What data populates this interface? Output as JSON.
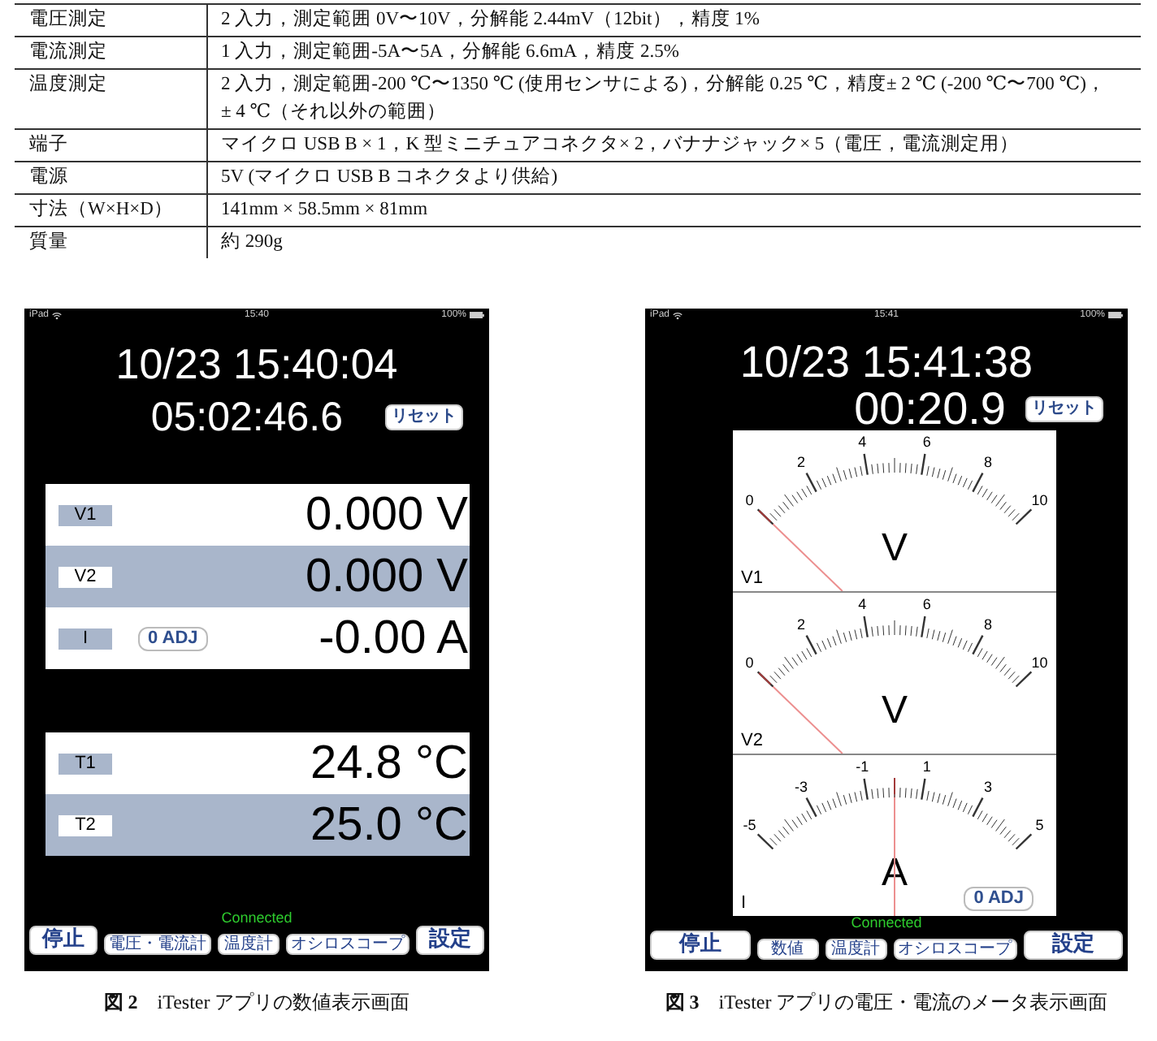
{
  "spec_table": {
    "rows": [
      {
        "item": "電圧測定",
        "lines": [
          "2 入力，測定範囲 0V〜10V，分解能 2.44mV（12bit），精度 1%"
        ]
      },
      {
        "item": "電流測定",
        "lines": [
          "1 入力，測定範囲-5A〜5A，分解能 6.6mA，精度 2.5%"
        ]
      },
      {
        "item": "温度測定",
        "lines": [
          "2 入力，測定範囲-200 ℃〜1350 ℃ (使用センサによる)，分解能 0.25 ℃，精度± 2 ℃ (-200 ℃〜700 ℃)，",
          "± 4 ℃（それ以外の範囲）"
        ]
      },
      {
        "item": "端子",
        "lines": [
          "マイクロ USB B × 1，K 型ミニチュアコネクタ× 2，バナナジャック× 5（電圧，電流測定用）"
        ]
      },
      {
        "item": "電源",
        "lines": [
          "5V (マイクロ USB B コネクタより供給)"
        ]
      },
      {
        "item": "寸法（W×H×D）",
        "lines": [
          "141mm × 58.5mm × 81mm"
        ]
      },
      {
        "item": "質量",
        "lines": [
          "約 290g"
        ]
      }
    ]
  },
  "figures": [
    {
      "kind": "numeric",
      "number": "図 2",
      "caption": "iTester アプリの数値表示画面",
      "screen": {
        "status_bar": {
          "device": "iPad",
          "time": "15:40",
          "battery": "100%"
        },
        "date_time": "10/23 15:40:04",
        "elapsed": "05:02:46.6",
        "reset_button": "リセット",
        "panels": [
          {
            "rows": [
              {
                "channel": "V1",
                "value": "0.000 V"
              },
              {
                "channel": "V2",
                "value": "0.000 V"
              },
              {
                "channel": "I",
                "adjust_button": "0 ADJ",
                "value": "-0.00 A"
              }
            ]
          },
          {
            "rows": [
              {
                "channel": "T1",
                "value": "24.8 °C"
              },
              {
                "channel": "T2",
                "value": "25.0 °C"
              }
            ]
          }
        ],
        "connection": "Connected",
        "buttons": [
          {
            "label": "停止",
            "kind": "large"
          },
          {
            "label": "電圧・電流計",
            "kind": "small"
          },
          {
            "label": "温度計",
            "kind": "small"
          },
          {
            "label": "オシロスコープ",
            "kind": "small"
          },
          {
            "label": "設定",
            "kind": "large"
          }
        ]
      }
    },
    {
      "kind": "meter",
      "number": "図 3",
      "caption": "iTester アプリの電圧・電流のメータ表示画面",
      "screen": {
        "status_bar": {
          "device": "iPad",
          "time": "15:41",
          "battery": "100%"
        },
        "date_time": "10/23 15:41:38",
        "elapsed": "00:20.9",
        "reset_button": "リセット",
        "meters": [
          {
            "channel": "V1",
            "unit": "V",
            "scale": [
              "0",
              "2",
              "4",
              "6",
              "8",
              "10"
            ],
            "level": 0
          },
          {
            "channel": "V2",
            "unit": "V",
            "scale": [
              "0",
              "2",
              "4",
              "6",
              "8",
              "10"
            ],
            "level": 0
          },
          {
            "channel": "I",
            "unit": "A",
            "scale": [
              "-5",
              "-3",
              "-1",
              "1",
              "3",
              "5"
            ],
            "level": 0.5,
            "adjust_button": "0 ADJ"
          }
        ],
        "connection": "Connected",
        "buttons": [
          {
            "label": "停止",
            "kind": "large"
          },
          {
            "label": "数値",
            "kind": "small"
          },
          {
            "label": "温度計",
            "kind": "small"
          },
          {
            "label": "オシロスコープ",
            "kind": "small"
          },
          {
            "label": "設定",
            "kind": "large"
          }
        ]
      }
    }
  ]
}
